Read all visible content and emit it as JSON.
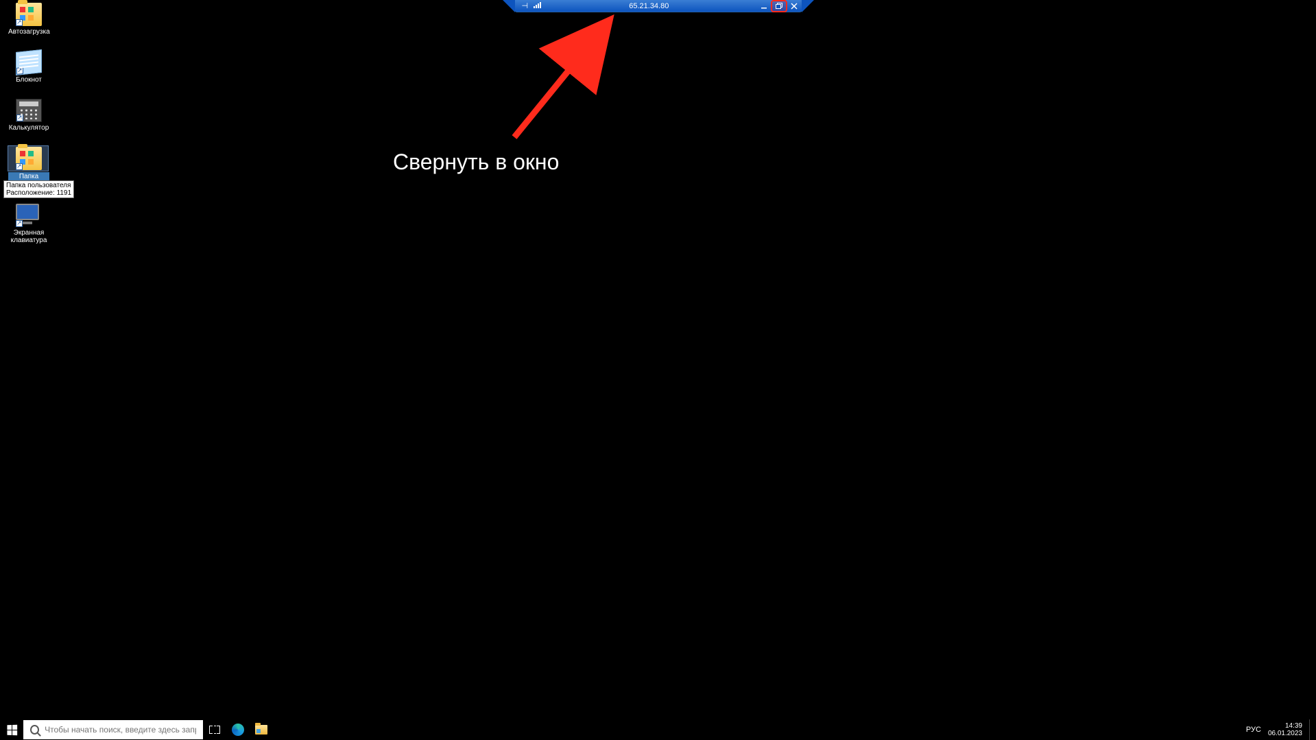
{
  "rdp": {
    "ip": "65.21.34.80"
  },
  "annotation": {
    "text": "Свернуть в окно"
  },
  "desktop_icons": [
    {
      "id": "autostart",
      "label": "Автозагрузка"
    },
    {
      "id": "notepad",
      "label": "Блокнот"
    },
    {
      "id": "calculator",
      "label": "Калькулятор"
    },
    {
      "id": "userfolder",
      "label": "Папка пользоват..."
    },
    {
      "id": "osk",
      "label": "Экранная клавиатура"
    }
  ],
  "tooltip": {
    "line1": "Папка пользователя",
    "line2": "Расположение: 1191"
  },
  "taskbar": {
    "search_placeholder": "Чтобы начать поиск, введите здесь запрос",
    "language": "РУС",
    "time": "14:39",
    "date": "06.01.2023"
  }
}
